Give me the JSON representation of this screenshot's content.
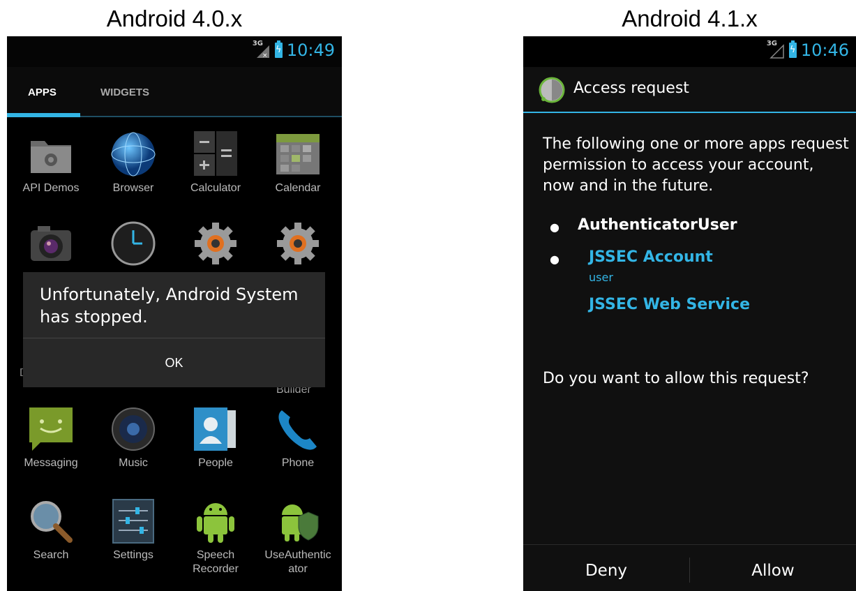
{
  "left": {
    "caption": "Android 4.0.x",
    "status": {
      "network": "3G",
      "time": "10:49"
    },
    "tabs": [
      "APPS",
      "WIDGETS"
    ],
    "apps": {
      "row1": [
        "API Demos",
        "Browser",
        "Calculator",
        "Calendar"
      ],
      "row_partial": [
        "D",
        "Builder"
      ],
      "row3": [
        "Messaging",
        "Music",
        "People",
        "Phone"
      ],
      "row4": [
        "Search",
        "Settings",
        "Speech Recorder",
        "UseAuthenticator"
      ]
    },
    "row4_labels": {
      "speech_l1": "Speech",
      "speech_l2": "Recorder",
      "use_l1": "UseAuthentic",
      "use_l2": "ator"
    },
    "dialog": {
      "message": "Unfortunately, Android System has stopped.",
      "ok": "OK"
    }
  },
  "right": {
    "caption": "Android 4.1.x",
    "status": {
      "network": "3G",
      "time": "10:46"
    },
    "title": "Access request",
    "body": "The following one or more apps request permission to access your account, now and in the future.",
    "requesters": {
      "user": "AuthenticatorUser",
      "account": "JSSEC Account",
      "account_sub": "user",
      "service": "JSSEC Web Service"
    },
    "question": "Do you want to allow this request?",
    "buttons": {
      "deny": "Deny",
      "allow": "Allow"
    }
  },
  "colors": {
    "accent": "#33b5e5",
    "dialog_bg": "#282828",
    "screen_bg": "#000000"
  }
}
